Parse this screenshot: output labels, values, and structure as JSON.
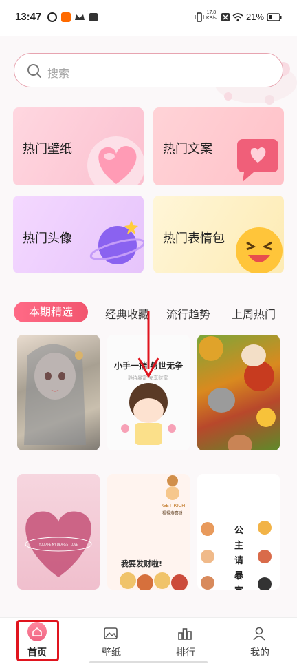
{
  "status_bar": {
    "time": "13:47",
    "network_speed_value": "17.8",
    "network_speed_unit": "KB/s",
    "battery": "21%",
    "icons": [
      "vibrate-icon",
      "sim-off-icon",
      "wifi-icon",
      "battery-icon"
    ]
  },
  "search": {
    "placeholder": "搜索"
  },
  "categories": [
    {
      "label": "热门壁纸",
      "icon": "heart-icon"
    },
    {
      "label": "热门文案",
      "icon": "chat-heart-icon"
    },
    {
      "label": "热门头像",
      "icon": "planet-icon"
    },
    {
      "label": "热门表情包",
      "icon": "emoji-laugh-icon"
    }
  ],
  "tabs": {
    "active": "本期精选",
    "items": [
      "经典收藏",
      "流行趋势",
      "上周热门"
    ]
  },
  "tiles": [
    {
      "name": "anime-girl-wallpaper"
    },
    {
      "name": "cartoon-girl-wallpaper",
      "text_top": "小手一揣 与世无争",
      "text_sub": "静待暴富·安享财富"
    },
    {
      "name": "hamster-cat-wallpaper"
    },
    {
      "name": "pink-heart-wallpaper",
      "text": "YOU ARE MY DEAREST LOVE"
    },
    {
      "name": "get-rich-wallpaper",
      "text_en": "GET RICH",
      "text_cn": "福禄寿喜财",
      "text_bottom": "我要发财啦!"
    },
    {
      "name": "princess-wallpaper",
      "text": "公主请暴富"
    }
  ],
  "bottom_nav": [
    {
      "label": "首页",
      "icon": "home-icon",
      "active": true
    },
    {
      "label": "壁纸",
      "icon": "image-icon"
    },
    {
      "label": "排行",
      "icon": "ranking-icon"
    },
    {
      "label": "我的",
      "icon": "user-icon"
    }
  ],
  "colors": {
    "accent": "#f2566f",
    "annotation": "#e0141e"
  }
}
